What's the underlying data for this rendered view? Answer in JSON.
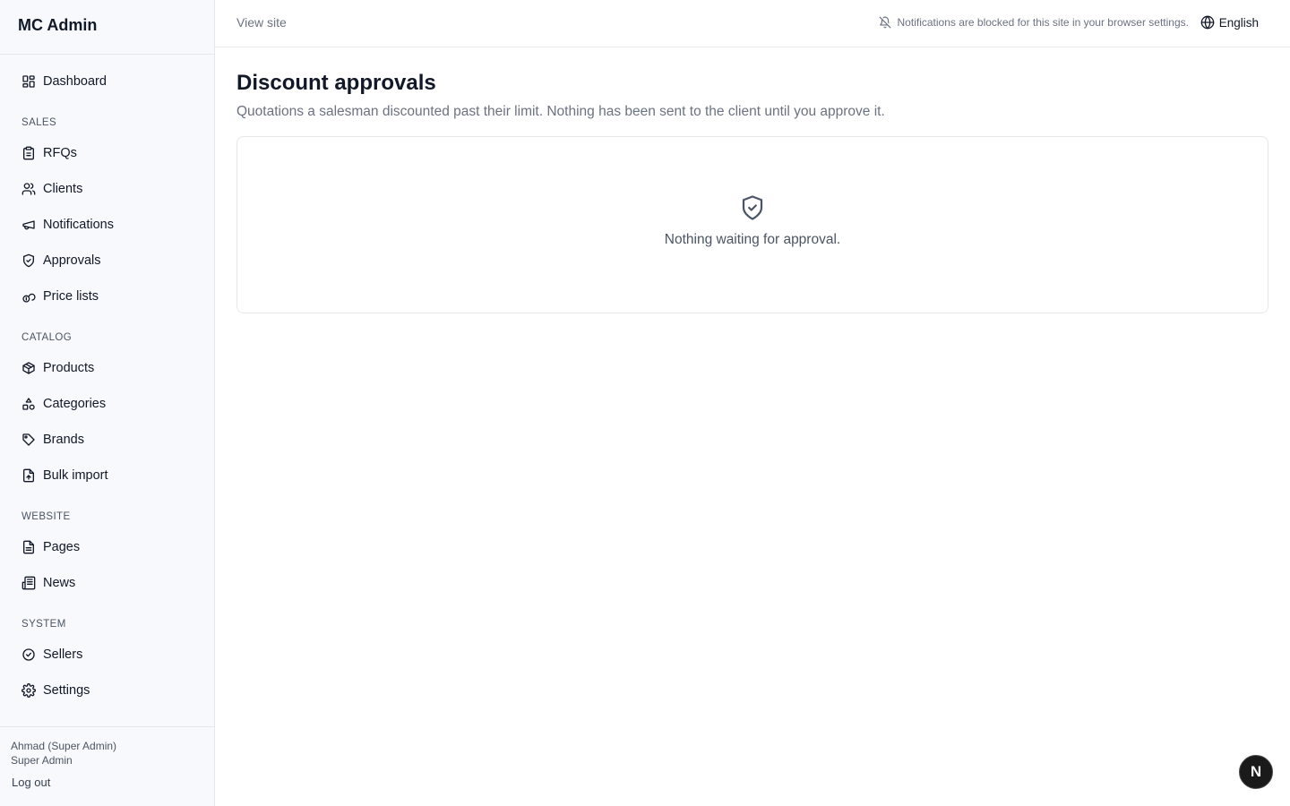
{
  "app": {
    "title": "MC Admin"
  },
  "sidebar": {
    "top": [
      {
        "label": "Dashboard",
        "icon": "dashboard-icon"
      }
    ],
    "sections": [
      {
        "label": "SALES",
        "items": [
          {
            "label": "RFQs",
            "icon": "clipboard-icon"
          },
          {
            "label": "Clients",
            "icon": "users-icon"
          },
          {
            "label": "Notifications",
            "icon": "megaphone-icon"
          },
          {
            "label": "Approvals",
            "icon": "shield-check-icon"
          },
          {
            "label": "Price lists",
            "icon": "coins-icon"
          }
        ]
      },
      {
        "label": "CATALOG",
        "items": [
          {
            "label": "Products",
            "icon": "package-icon"
          },
          {
            "label": "Categories",
            "icon": "shapes-icon"
          },
          {
            "label": "Brands",
            "icon": "tag-icon"
          },
          {
            "label": "Bulk import",
            "icon": "file-upload-icon"
          }
        ]
      },
      {
        "label": "WEBSITE",
        "items": [
          {
            "label": "Pages",
            "icon": "file-text-icon"
          },
          {
            "label": "News",
            "icon": "newspaper-icon"
          }
        ]
      },
      {
        "label": "SYSTEM",
        "items": [
          {
            "label": "Sellers",
            "icon": "badge-check-icon"
          },
          {
            "label": "Settings",
            "icon": "gear-icon"
          }
        ]
      }
    ],
    "footer": {
      "user_name": "Ahmad (Super Admin)",
      "user_role": "Super Admin",
      "logout_label": "Log out"
    }
  },
  "topbar": {
    "view_site": "View site",
    "notification_notice": "Notifications are blocked for this site in your browser settings.",
    "language": "English"
  },
  "main": {
    "title": "Discount approvals",
    "subtitle": "Quotations a salesman discounted past their limit. Nothing has been sent to the client until you approve it.",
    "empty_text": "Nothing waiting for approval."
  },
  "dev_badge": {
    "label": "N"
  }
}
